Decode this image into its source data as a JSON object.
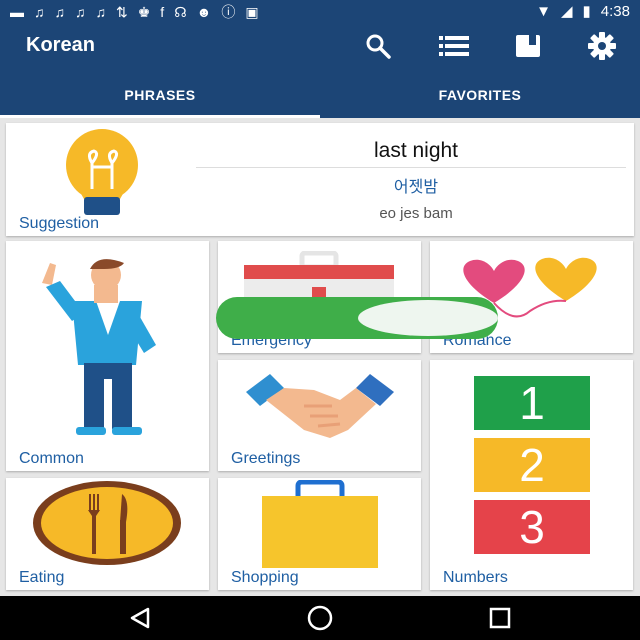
{
  "status_bar": {
    "time": "4:38",
    "icons": [
      "message-icon",
      "music-icon",
      "music-icon",
      "music-icon",
      "music-icon",
      "data-icon",
      "trophy-icon",
      "facebook-icon",
      "headset-icon",
      "cat-icon",
      "info-icon",
      "lock-icon",
      "wifi-icon",
      "signal-icon",
      "battery-icon"
    ]
  },
  "app_bar": {
    "title": "Korean",
    "actions": [
      "search-icon",
      "list-icon",
      "book-icon",
      "gear-icon"
    ]
  },
  "tabs": [
    {
      "label": "PHRASES",
      "selected": true
    },
    {
      "label": "FAVORITES",
      "selected": false
    }
  ],
  "suggestion": {
    "label": "Suggestion",
    "english": "last night",
    "korean": "어젯밤",
    "romanization": "eo jes bam"
  },
  "categories": {
    "common": "Common",
    "emergency": "Emergency",
    "romance": "Romance",
    "greetings": "Greetings",
    "eating": "Eating",
    "shopping": "Shopping",
    "numbers": "Numbers",
    "number_digits": [
      "1",
      "2",
      "3"
    ]
  },
  "colors": {
    "primary": "#1c4576",
    "label": "#1f5fa3",
    "toggle": "#3fae49"
  }
}
